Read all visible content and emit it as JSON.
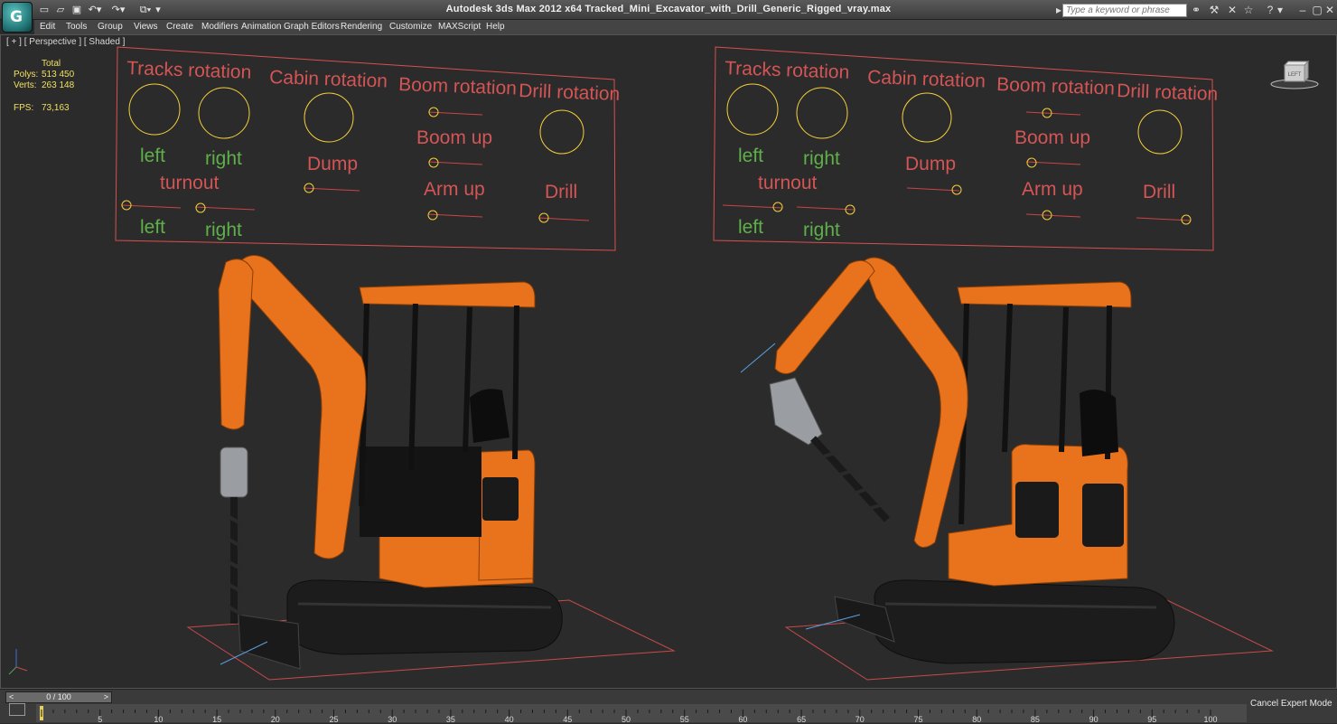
{
  "app": {
    "title": "Autodesk 3ds Max  2012 x64     Tracked_Mini_Excavator_with_Drill_Generic_Rigged_vray.max",
    "search_placeholder": "Type a keyword or phrase"
  },
  "menu": [
    "Edit",
    "Tools",
    "Group",
    "Views",
    "Create",
    "Modifiers",
    "Animation",
    "Graph Editors",
    "Rendering",
    "Customize",
    "MAXScript",
    "Help"
  ],
  "viewport": {
    "label": "[ + ] [ Perspective ] [ Shaded ]",
    "stats": {
      "header": "Total",
      "polys_label": "Polys:",
      "polys_value": "513 450",
      "verts_label": "Verts:",
      "verts_value": "263 148",
      "fps_label": "FPS:",
      "fps_value": "73,163"
    },
    "viewcube_label": "LEFT"
  },
  "control_panel": {
    "tracks_rotation": "Tracks rotation",
    "cabin_rotation": "Cabin rotation",
    "boom_rotation": "Boom rotation",
    "drill_rotation": "Drill rotation",
    "left": "left",
    "right": "right",
    "turnout": "turnout",
    "dump": "Dump",
    "boom_up": "Boom up",
    "arm_up": "Arm  up",
    "drill": "Drill"
  },
  "timeline": {
    "slider_label": "0 / 100",
    "ticks": [
      "5",
      "10",
      "15",
      "20",
      "25",
      "30",
      "35",
      "40",
      "45",
      "50",
      "55",
      "60",
      "65",
      "70",
      "75",
      "80",
      "85",
      "90",
      "95",
      "100"
    ],
    "cancel_label": "Cancel Expert Mode"
  },
  "colors": {
    "panel_line": "#d85050",
    "label_red": "#d45555",
    "label_green": "#5fb04a",
    "control_ring": "#f4d03c",
    "excavator_orange": "#e8731c"
  }
}
